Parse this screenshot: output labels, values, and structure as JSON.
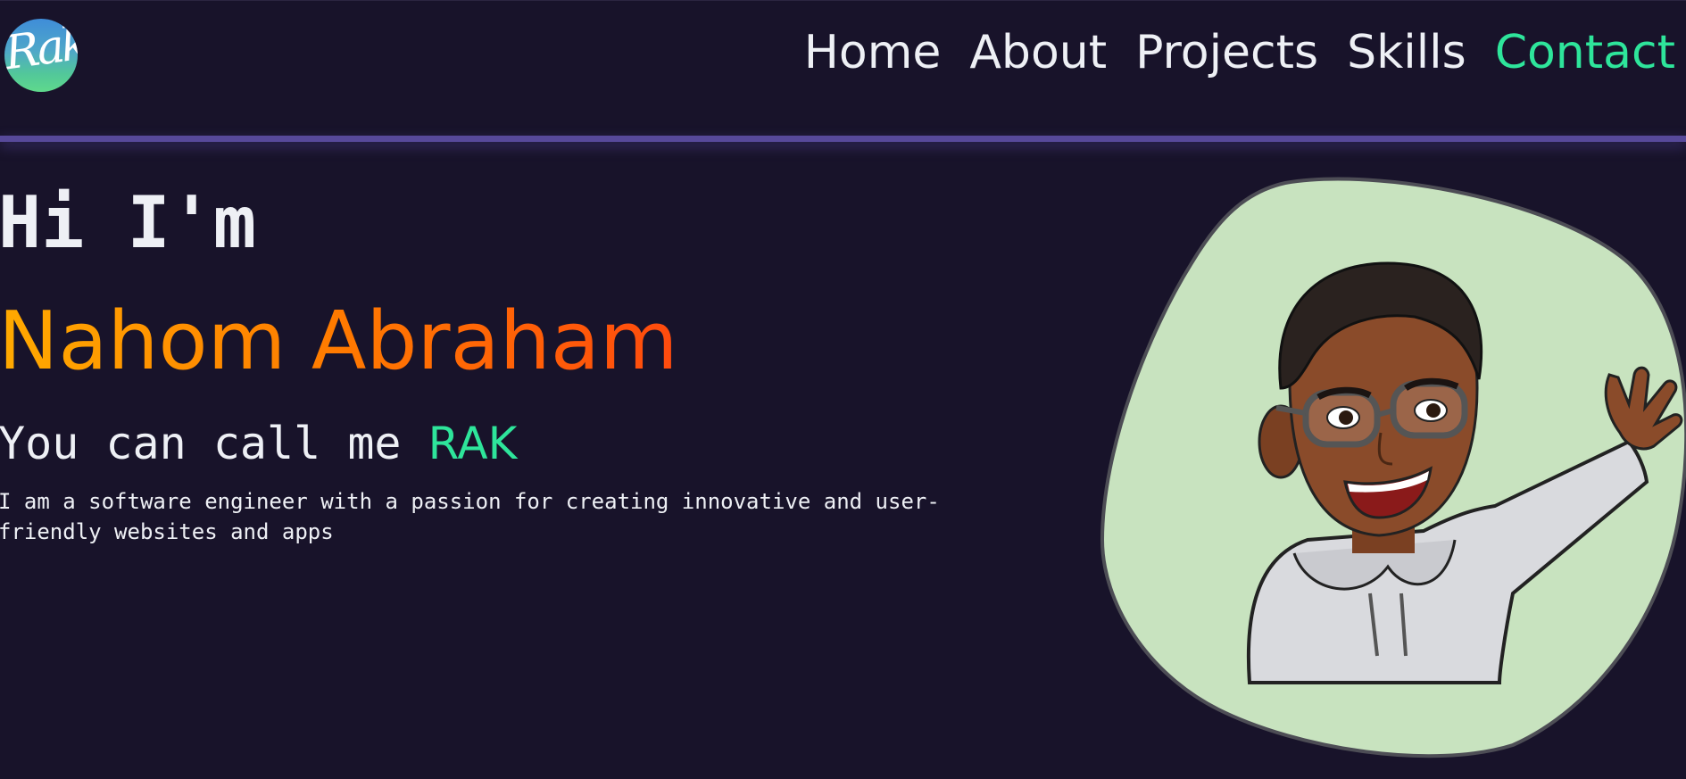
{
  "header": {
    "logo_text": "Rak",
    "nav": [
      {
        "label": "Home"
      },
      {
        "label": "About"
      },
      {
        "label": "Projects"
      },
      {
        "label": "Skills"
      },
      {
        "label": "Contact",
        "active": true
      }
    ]
  },
  "hero": {
    "greeting": "Hi I'm",
    "name": "Nahom Abraham",
    "tagline_prefix": "You can call me",
    "nickname": "RAK",
    "description": "I am a software engineer with a passion for creating innovative and user-friendly websites and apps",
    "avatar_icon": "waving-avatar-icon"
  },
  "colors": {
    "background": "#18132a",
    "accent_green": "#2ee59b",
    "name_gradient_start": "#ffaa00",
    "name_gradient_end": "#ff4a0e",
    "divider": "#57499a",
    "blob": "#c8e3bf"
  }
}
